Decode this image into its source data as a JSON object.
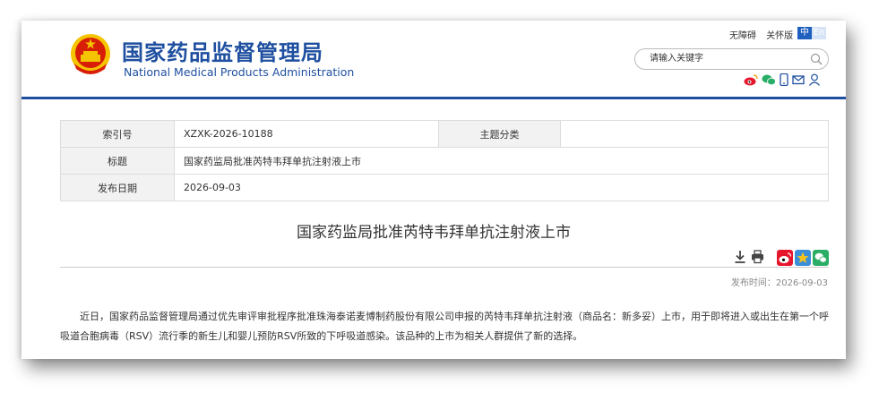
{
  "header": {
    "title_cn": "国家药品监督管理局",
    "title_en": "National Medical Products Administration",
    "top_links": [
      "无障碍",
      "关怀版"
    ],
    "lang_cn": "中",
    "lang_en": "En",
    "search_placeholder": "请输入关键字",
    "social_icons": [
      "weibo-icon",
      "wechat-icon",
      "mobile-icon",
      "mail-icon",
      "user-icon"
    ]
  },
  "info_table": {
    "index_label": "索引号",
    "index_value": "XZXK-2026-10188",
    "category_label": "主题分类",
    "category_value": "",
    "title_label": "标题",
    "title_value": "国家药监局批准芮特韦拜单抗注射液上市",
    "date_label": "发布日期",
    "date_value": "2026-09-03"
  },
  "article": {
    "title": "国家药监局批准芮特韦拜单抗注射液上市",
    "tool_icons": [
      "download-icon",
      "print-icon"
    ],
    "share_icons": [
      "weibo-share-icon",
      "qzone-share-icon",
      "wechat-share-icon"
    ],
    "publish_time": "发布时间：2026-09-03",
    "body": "近日，国家药品监督管理局通过优先审评审批程序批准珠海泰诺麦博制药股份有限公司申报的芮特韦拜单抗注射液（商品名：新多妥）上市，用于即将进入或出生在第一个呼吸道合胞病毒（RSV）流行季的新生儿和婴儿预防RSV所致的下呼吸道感染。该品种的上市为相关人群提供了新的选择。"
  },
  "colors": {
    "brand_blue": "#1f4fa0",
    "emblem_red": "#d81e06",
    "emblem_gold": "#f5c400"
  }
}
